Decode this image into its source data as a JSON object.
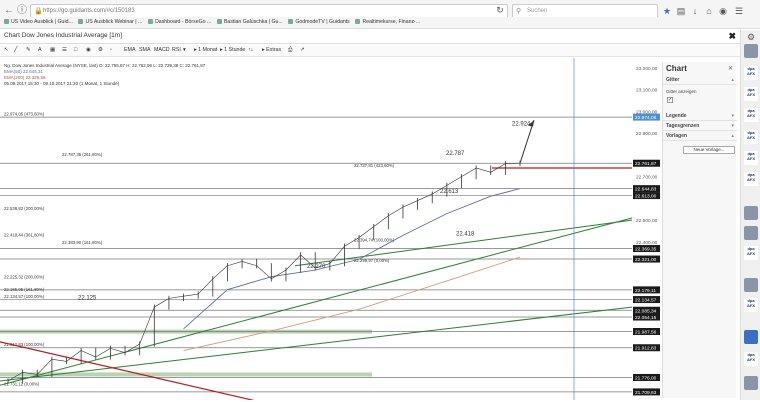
{
  "browser": {
    "url": "https://go.guidants.com/#c/150183",
    "search_placeholder": "Suchen"
  },
  "bookmarks": [
    "US Video Ausblick | Guid...",
    "US Ausblick Webinar | ...",
    "Dashboard - BörseGo ...",
    "Bastian Galuschka | Gu...",
    "GodmodeTV | Guidants",
    "Realtimekurse, Finanz-..."
  ],
  "window": {
    "title": "Chart Dow Jones Industrial Average [1m]"
  },
  "toolbar": {
    "items": [
      "EMA",
      "SMA",
      "MACD",
      "RSI",
      "1 Monat",
      "1 Stunde",
      "Extras"
    ]
  },
  "legend": {
    "line1": "Ng. Dow Jones Industrial Average (NYSE, last)  O: 22.755,87  H: 22.762,96  L: 22.739,38  C: 22.761,87",
    "line2": "EMA(50)  22.645,31",
    "line3": "EMA(200)  22.329,56",
    "line4": "05.09.2017 15:30 - 09.10.2017 21:30  (1 Monat, 1 Stunde)"
  },
  "colors": {
    "price": "#333333",
    "ema50": "#5a6ea8",
    "ema200": "#d49a7a",
    "green_trend": "#2e7d32",
    "red_trend": "#b71c1c",
    "current_price_box": "#1a1a1a",
    "highlight_box": "#4a90d9"
  },
  "axis_labels": [
    {
      "label": "23.200,00",
      "type": "grid"
    },
    {
      "label": "23.100,00",
      "type": "grid"
    },
    {
      "label": "23.000,00",
      "type": "grid"
    },
    {
      "label": "22.974,06",
      "type": "highlight"
    },
    {
      "label": "22.900,00",
      "type": "grid"
    },
    {
      "label": "22.761,87",
      "type": "price"
    },
    {
      "label": "22.700,00",
      "type": "grid"
    },
    {
      "label": "22.644,83",
      "type": "price"
    },
    {
      "label": "22.613,00",
      "type": "price"
    },
    {
      "label": "22.500,00",
      "type": "grid"
    },
    {
      "label": "22.400,00",
      "type": "grid"
    },
    {
      "label": "22.369,35",
      "type": "price"
    },
    {
      "label": "22.321,00",
      "type": "price"
    },
    {
      "label": "22.179,11",
      "type": "price"
    },
    {
      "label": "22.134,57",
      "type": "price"
    },
    {
      "label": "22.085,34",
      "type": "price"
    },
    {
      "label": "22.054,15",
      "type": "price"
    },
    {
      "label": "21.987,56",
      "type": "price"
    },
    {
      "label": "21.912,83",
      "type": "price"
    },
    {
      "label": "21.776,00",
      "type": "price"
    },
    {
      "label": "21.709,63",
      "type": "price"
    }
  ],
  "fib_labels": [
    "22.974,05 (473,60%)",
    "22.787,35 (261,80%)",
    "22.737,81 (423,60%)",
    "22.538,82 (200,00%)",
    "22.418,44 (361,80%)",
    "22.383,90 (161,80%)",
    "22.394,74 (100,00%)",
    "22.299,97 (0,00%)",
    "22.225,32 (200,00%)",
    "22.134,57 (100,00%)",
    "22.165,95 (161,80%)",
    "21.912,83 (100,00%)",
    "21.731,12 (0,00%)"
  ],
  "annotations": [
    "22.924",
    "22.787",
    "22.613",
    "22.418",
    "22.270",
    "22.125"
  ],
  "side_panel": {
    "title": "Chart",
    "section_gitter": "Gitter",
    "gitter_label": "Gitter anzeigen",
    "section_legende": "Legende",
    "section_tagesgrenzen": "Tagesgrenzen",
    "section_vorlagen": "Vorlagen",
    "new_template_button": "Neue Vorlage...",
    "logo_text": "dpa AFX"
  },
  "chart_data": {
    "type": "line",
    "title": "Dow Jones Industrial Average [1m]",
    "ylim": [
      21700,
      23200
    ],
    "series": [
      {
        "name": "Dow Jones Industrial Average",
        "x": [
          0,
          4,
          8,
          12,
          16,
          20,
          24,
          28,
          32,
          36,
          40,
          44,
          48,
          52,
          56,
          60,
          64,
          68,
          72,
          76,
          80,
          84,
          88,
          92,
          96,
          100,
          104,
          108,
          112,
          116,
          120,
          124,
          128,
          132,
          136,
          140
        ],
        "values": [
          21760,
          21800,
          21790,
          21860,
          21850,
          21900,
          21870,
          21910,
          21890,
          21930,
          22100,
          22140,
          22150,
          22160,
          22230,
          22290,
          22310,
          22290,
          22230,
          22270,
          22340,
          22280,
          22300,
          22380,
          22420,
          22470,
          22520,
          22560,
          22590,
          22620,
          22660,
          22700,
          22740,
          22720,
          22760,
          22762
        ]
      },
      {
        "name": "EMA(50)",
        "x": [
          48,
          60,
          72,
          84,
          96,
          108,
          120,
          132,
          140
        ],
        "values": [
          22000,
          22180,
          22240,
          22270,
          22320,
          22430,
          22530,
          22610,
          22645
        ]
      },
      {
        "name": "EMA(200)",
        "x": [
          48,
          72,
          96,
          120,
          140
        ],
        "values": [
          21900,
          21990,
          22090,
          22220,
          22330
        ]
      }
    ]
  }
}
